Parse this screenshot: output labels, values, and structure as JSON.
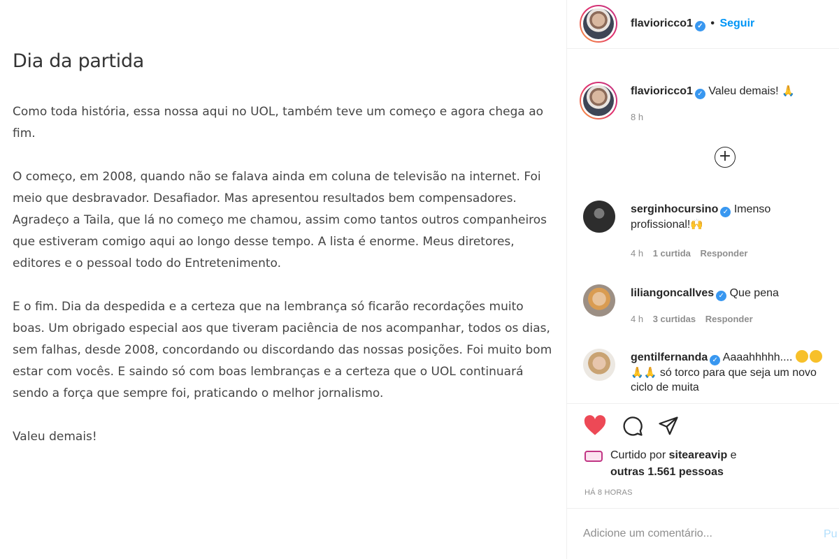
{
  "post": {
    "title": "Dia da partida",
    "paragraphs": [
      "Como toda história, essa nossa aqui no UOL, também teve um começo e agora chega ao fim.",
      "O começo, em 2008, quando não se falava ainda em coluna de televisão na internet. Foi meio que desbravador. Desafiador. Mas apresentou resultados bem compensadores. Agradeço a Taila, que lá no começo me chamou, assim como tantos outros companheiros que estiveram comigo aqui ao longo desse tempo. A lista é enorme. Meus diretores, editores e o pessoal todo do Entretenimento.",
      "E o fim. Dia da despedida e a certeza que na lembrança só ficarão recordações muito boas. Um obrigado especial aos que tiveram paciência de nos acompanhar, todos os dias, sem falhas, desde 2008, concordando ou discordando das nossas posições. Foi muito bom estar com vocês. E saindo só com boas lembranças e a certeza que o UOL continuará sendo a força que sempre foi, praticando o melhor jornalismo.",
      "Valeu demais!"
    ]
  },
  "header": {
    "username": "flavioricco1",
    "dot": "•",
    "follow_label": "Seguir"
  },
  "caption": {
    "username": "flavioricco1",
    "text": "Valeu demais!",
    "emoji": "🙏",
    "time": "8 h"
  },
  "load_more": "+",
  "comments": [
    {
      "username": "serginhocursino",
      "text": "Imenso profissional!",
      "emoji": "🙌",
      "time": "4 h",
      "likes": "1 curtida",
      "reply": "Responder"
    },
    {
      "username": "liliangoncallves",
      "text": "Que pena",
      "time": "4 h",
      "likes": "3 curtidas",
      "reply": "Responder"
    },
    {
      "username": "gentilfernanda",
      "text_a": "Aaaahhhhh....",
      "emoji_pray": "🙏🙏",
      "text_b": "só torco para que seja um novo ciclo de muita"
    }
  ],
  "likes": {
    "prefix": "Curtido por",
    "user": "siteareavip",
    "connector": "e",
    "others": "outras 1.561 pessoas"
  },
  "post_age": "HÁ 8 HORAS",
  "comment_box": {
    "placeholder": "Adicione um comentário...",
    "publish_label": "Pu"
  },
  "colors": {
    "verified": "#3897f0",
    "follow": "#0095f6",
    "heart": "#ed4956",
    "publish_disabled": "#b2dffc"
  },
  "icons": [
    "verified-badge-icon",
    "plus-circle-icon",
    "heart-icon",
    "comment-icon",
    "share-icon",
    "reel-icon"
  ]
}
